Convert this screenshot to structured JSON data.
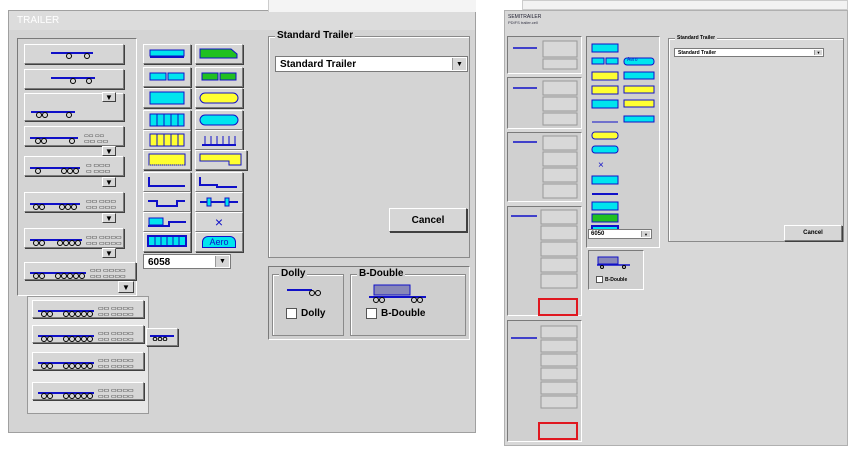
{
  "left_window": {
    "title": "TRAILER",
    "standard_trailer_group": {
      "title": "Standard Trailer",
      "selected": "Standard Trailer"
    },
    "cancel_label": "Cancel",
    "model_combo_value": "6058",
    "dolly_group": {
      "title": "Dolly",
      "checkbox_label": "Dolly"
    },
    "bdouble_group": {
      "title": "B-Double",
      "checkbox_label": "B-Double"
    },
    "aero_label": "Aero",
    "x_label": "×"
  },
  "right_window": {
    "title": "SEMITRAILER",
    "subtitle": "PDIFS trailer.cell",
    "standard_trailer_group": {
      "title": "Standard Trailer",
      "selected": "Standard Trailer"
    },
    "cancel_label": "Cancel",
    "model_combo_value": "6050",
    "aero_label": "Aero",
    "x_label": "×",
    "bdouble_label": "B-Double"
  },
  "colors": {
    "cyan": "#00e5ee",
    "blue": "#1010c8",
    "yellow": "#ffff30",
    "green": "#20c020",
    "highlight": "#e01820"
  }
}
